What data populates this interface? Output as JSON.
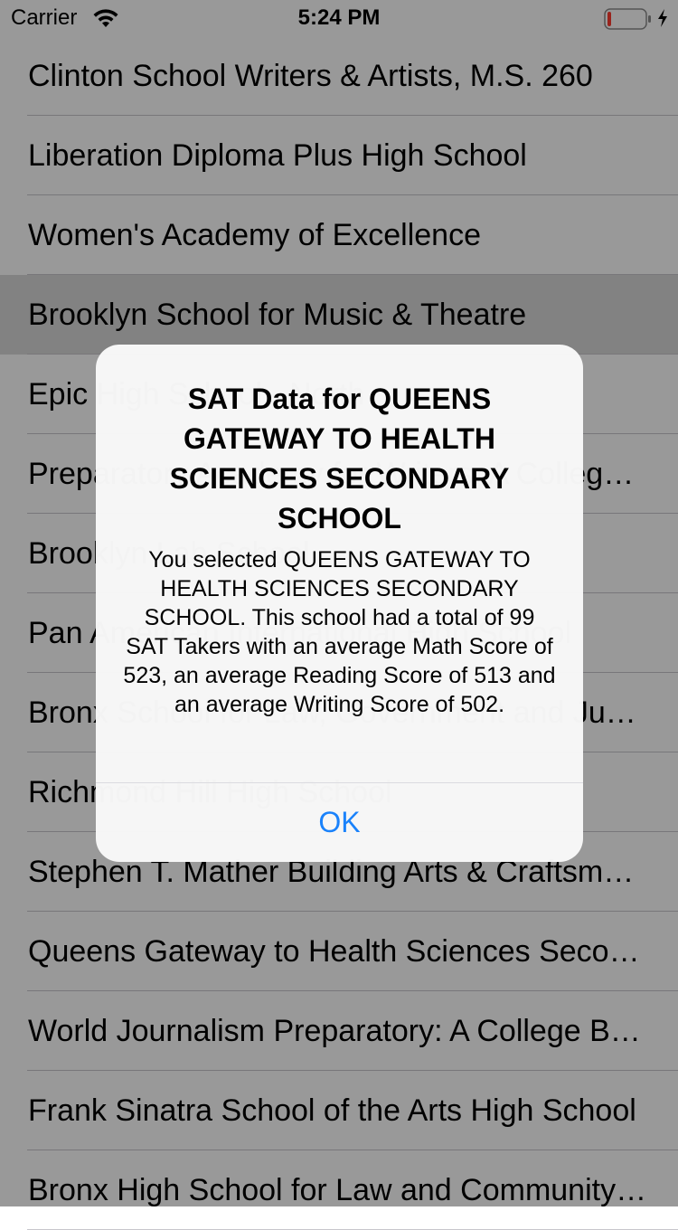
{
  "status_bar": {
    "carrier": "Carrier",
    "time": "5:24 PM",
    "battery_level": 0.1
  },
  "colors": {
    "accent": "#1a82fb",
    "battery_low": "#ff3b30"
  },
  "school_list": {
    "items": [
      {
        "label": "Clinton School Writers & Artists, M.S. 260"
      },
      {
        "label": "Liberation Diploma Plus High School"
      },
      {
        "label": "Women's Academy of Excellence"
      },
      {
        "label": "Brooklyn School for Music & Theatre",
        "selected": true
      },
      {
        "label": "Epic High School - North"
      },
      {
        "label": "Preparatory Academy for Writers: A College Board School"
      },
      {
        "label": "Brooklyn Lab School"
      },
      {
        "label": "Pan American International High School"
      },
      {
        "label": "Bronx School for Law, Government and Justice"
      },
      {
        "label": "Richmond Hill High School"
      },
      {
        "label": "Stephen T. Mather Building Arts & Craftsmanship High School"
      },
      {
        "label": "Queens Gateway to Health Sciences Secondary School"
      },
      {
        "label": "World Journalism Preparatory: A College Board School"
      },
      {
        "label": "Frank Sinatra School of the Arts High School"
      },
      {
        "label": "Bronx High School for Law and Community Service"
      }
    ]
  },
  "alert": {
    "title": "SAT Data for QUEENS GATEWAY TO HEALTH SCIENCES SECONDARY SCHOOL",
    "message": "You selected QUEENS GATEWAY TO HEALTH SCIENCES SECONDARY SCHOOL. This school had a total of 99 SAT Takers with an average Math Score of 523, an average Reading Score of 513 and an average Writing Score of 502.",
    "ok_label": "OK"
  }
}
